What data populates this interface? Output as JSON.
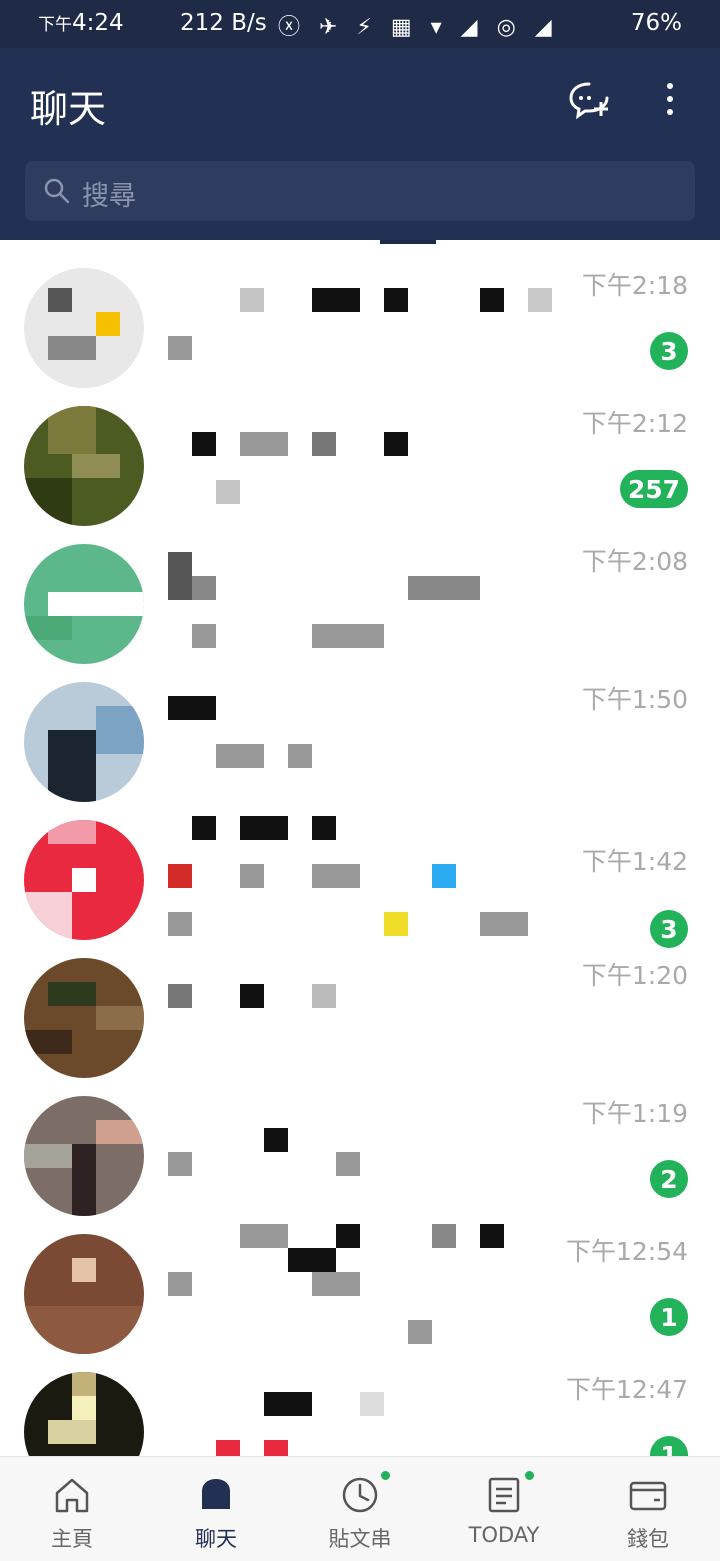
{
  "status_bar": {
    "time_prefix": "下午",
    "time": "4:24",
    "net_speed": "212 B/s",
    "icons": "ⓧ ✈ ⚡ ▦ ▾ ◢ ◎ ◢",
    "battery": "76%"
  },
  "header": {
    "title": "聊天",
    "icons": [
      "new-chat-icon",
      "more-icon"
    ]
  },
  "search": {
    "placeholder": "搜尋"
  },
  "chats": [
    {
      "time": "下午2:18",
      "badge": "3",
      "avatar_colors": [
        "#555",
        "#f5c000",
        "#fff",
        "#888"
      ]
    },
    {
      "time": "下午2:12",
      "badge": "257",
      "avatar_colors": [
        "#4b5b22",
        "#7d7a3d",
        "#2f3b13",
        "#908d55"
      ]
    },
    {
      "time": "下午2:08",
      "badge": "",
      "avatar_colors": [
        "#5cb88a",
        "#fff",
        "#4aa977",
        "#7cc9a2"
      ]
    },
    {
      "time": "下午1:50",
      "badge": "",
      "avatar_colors": [
        "#b9cad9",
        "#1a2531",
        "#7da3c4",
        "#0f1720"
      ]
    },
    {
      "time": "下午1:42",
      "badge": "3",
      "avatar_colors": [
        "#e8293f",
        "#fff",
        "#f29aa7",
        "#d31b32"
      ]
    },
    {
      "time": "下午1:20",
      "badge": "",
      "avatar_colors": [
        "#6b4a2c",
        "#3d2a1a",
        "#8b6d4a",
        "#2e3a1e"
      ]
    },
    {
      "time": "下午1:19",
      "badge": "2",
      "avatar_colors": [
        "#7c6d66",
        "#d0a08f",
        "#2e2322",
        "#a6a39b"
      ]
    },
    {
      "time": "下午12:54",
      "badge": "1",
      "avatar_colors": [
        "#7b4a34",
        "#6e3e2a",
        "#e5c3a8",
        "#8d5a41"
      ]
    },
    {
      "time": "下午12:47",
      "badge": "1",
      "avatar_colors": [
        "#1b1a11",
        "#c2b178",
        "#f3f0bc",
        "#2b2b1f"
      ]
    }
  ],
  "bottom_nav": [
    {
      "label": "主頁",
      "icon": "home-icon"
    },
    {
      "label": "聊天",
      "icon": "chat-icon"
    },
    {
      "label": "貼文串",
      "icon": "clock-icon"
    },
    {
      "label": "TODAY",
      "icon": "news-icon"
    },
    {
      "label": "錢包",
      "icon": "wallet-icon"
    }
  ],
  "colors": {
    "header_bg": "#223153",
    "badge_green": "#21b25a",
    "timestamp_gray": "#a9a9a9"
  }
}
